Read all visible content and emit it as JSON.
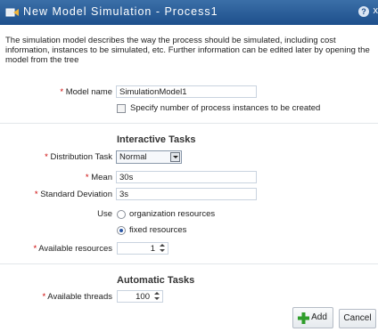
{
  "dialog": {
    "title": "New Model Simulation - Process1",
    "help_label": "?",
    "close_label": "x",
    "intro": "The simulation model describes the way the process should be simulated, including cost information, instances to be simulated, etc. Further information can be edited later by opening the model from the tree"
  },
  "required_marker": "*",
  "form": {
    "model_name_label": "Model name",
    "model_name_value": "SimulationModel1",
    "specify_instances_label": "Specify number of process instances to be created",
    "specify_instances_checked": false
  },
  "interactive": {
    "heading": "Interactive Tasks",
    "distribution_label": "Distribution Task",
    "distribution_value": "Normal",
    "mean_label": "Mean",
    "mean_value": "30s",
    "stddev_label": "Standard Deviation",
    "stddev_value": "3s",
    "use_label": "Use",
    "use_options": [
      "organization resources",
      "fixed resources"
    ],
    "use_selected": "fixed resources",
    "available_resources_label": "Available resources",
    "available_resources_value": "1"
  },
  "automatic": {
    "heading": "Automatic Tasks",
    "available_threads_label": "Available threads",
    "available_threads_value": "100"
  },
  "buttons": {
    "add_label": "Add",
    "cancel_label": "Cancel"
  },
  "colors": {
    "titlebar": "#1d4f8c",
    "required": "#cc0000",
    "add_icon": "#2f9d2a"
  }
}
